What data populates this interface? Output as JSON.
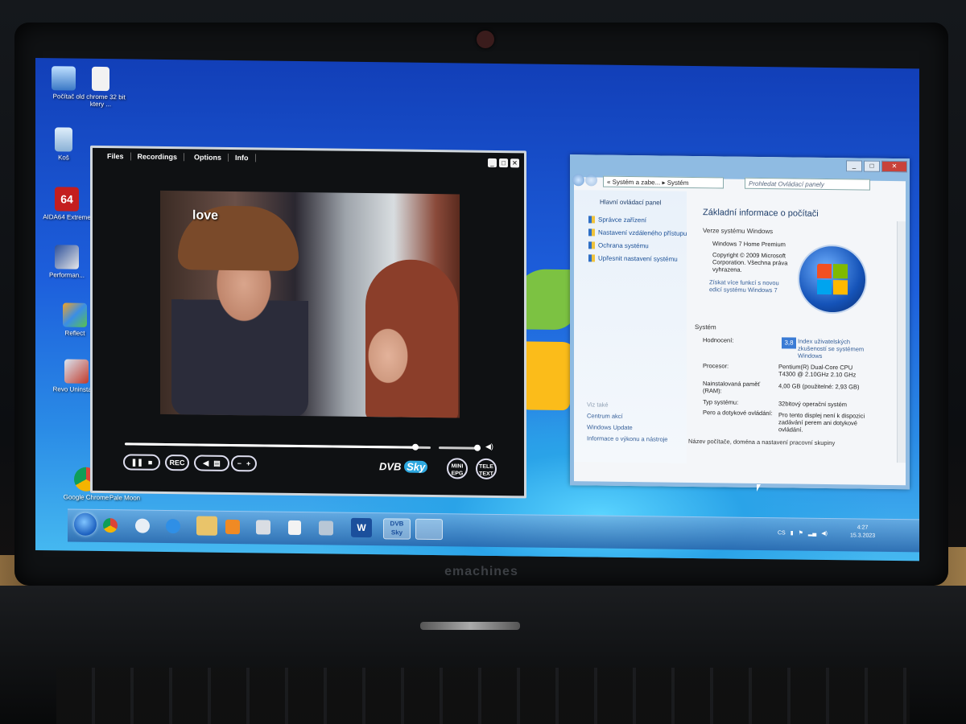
{
  "laptop": {
    "brand": "emachines"
  },
  "desktop_icons": [
    {
      "label": "Počítač",
      "icon": "computer-icon"
    },
    {
      "label": "old chrome 32 bit ktery ...",
      "icon": "file-icon"
    },
    {
      "label": "Koš",
      "icon": "recycle-bin-icon"
    },
    {
      "label": "AIDA64 Extreme",
      "icon": "aida64-icon"
    },
    {
      "label": "Performan...",
      "icon": "performance-icon"
    },
    {
      "label": "Reflect",
      "icon": "reflect-icon"
    },
    {
      "label": "Revo Uninstaller",
      "icon": "revo-uninstaller-icon"
    },
    {
      "label": "Google Chrome",
      "icon": "chrome-icon"
    },
    {
      "label": "Pale Moon",
      "icon": "pale-moon-icon"
    }
  ],
  "media_player": {
    "menu": [
      "Files",
      "Recordings",
      "Options",
      "Info"
    ],
    "video_overlay_text": "love",
    "seek_position": 0.95,
    "volume_level": 0.92,
    "buttons": {
      "rec": "REC",
      "mini_epg": "MINI EPG",
      "teletext": "TELE TEXT",
      "minus": "−",
      "plus": "+"
    },
    "brand": "DVB",
    "brand_sky": "Sky"
  },
  "control_panel": {
    "breadcrumb": "« Systém a zabe... ▸ Systém",
    "search_placeholder": "Prohledat Ovládací panely",
    "side_home": "Hlavní ovládací panel",
    "side_links": [
      "Správce zařízení",
      "Nastavení vzdáleného přístupu",
      "Ochrana systému",
      "Upřesnit nastavení systému"
    ],
    "see_also_title": "Viz také",
    "see_also": [
      "Centrum akcí",
      "Windows Update",
      "Informace o výkonu a nástroje"
    ],
    "heading": "Základní informace o počítači",
    "section_edition": "Verze systému Windows",
    "edition": "Windows 7 Home Premium",
    "copyright": "Copyright © 2009 Microsoft Corporation. Všechna práva vyhrazena.",
    "more_features": "Získat více funkcí s novou edicí systému Windows 7",
    "section_system": "Systém",
    "rating_label": "Hodnocení:",
    "rating_badge": "3,8",
    "rating_value": "Index uživatelských zkušeností se systémem Windows",
    "processor_label": "Procesor:",
    "processor_value": "Pentium(R) Dual-Core CPU T4300 @ 2.10GHz 2.10 GHz",
    "ram_label": "Nainstalovaná paměť (RAM):",
    "ram_value": "4,00 GB (použitelné: 2,93 GB)",
    "type_label": "Typ systému:",
    "type_value": "32bitový operační systém",
    "pen_label": "Pero a dotykové ovládání:",
    "pen_value": "Pro tento displej není k dispozici zadávání perem ani dotykové ovládání.",
    "section_name": "Název počítače, doména a nastavení pracovní skupiny"
  },
  "taskbar": {
    "language": "CS",
    "time": "4:27",
    "date": "15.3.2023",
    "pinned": [
      "chrome-icon",
      "pale-moon-icon",
      "ie-icon",
      "explorer-icon",
      "media-icon",
      "notepad-icon",
      "file-icon",
      "paint-icon",
      "word-icon",
      "dvbsky-icon",
      "control-panel-icon"
    ]
  }
}
